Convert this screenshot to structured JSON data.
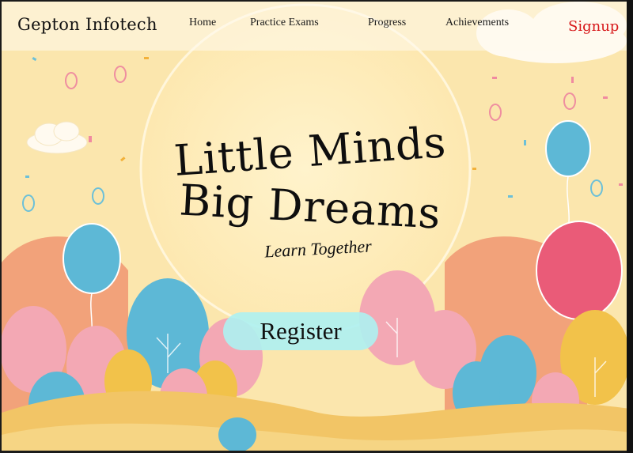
{
  "brand": {
    "name": "Gepton Infotech"
  },
  "nav": {
    "items": [
      {
        "label": "Home"
      },
      {
        "label": "Practice Exams"
      },
      {
        "label": "Progress"
      },
      {
        "label": "Achievements"
      }
    ],
    "signup_label": "Signup"
  },
  "hero": {
    "title_line1": "Little Minds",
    "title_line2": "Big Dreams",
    "tagline": "Learn Together",
    "cta_label": "Register"
  },
  "colors": {
    "background": "#fbe6ad",
    "signup": "#d7191b",
    "cta": "#aff0f0",
    "balloon_blue": "#5db8d6",
    "balloon_pink": "#ea5b78",
    "tree_orange": "#f2a27a",
    "tree_yellow": "#f2c24a"
  },
  "icons": [
    "cloud-icon",
    "balloon-icon",
    "tree-icon",
    "confetti-icon"
  ]
}
